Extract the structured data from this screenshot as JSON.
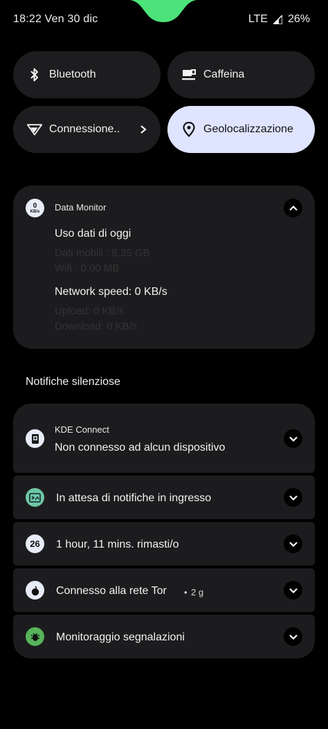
{
  "status_bar": {
    "time_date": "18:22 Ven 30 dic",
    "network": "LTE",
    "battery": "26%"
  },
  "quick_settings": [
    {
      "label": "Bluetooth",
      "icon": "bluetooth-icon",
      "active": false
    },
    {
      "label": "Caffeina",
      "icon": "coffee-cup-icon",
      "active": false
    },
    {
      "label": "Connessione..",
      "icon": "wifi-signal-icon",
      "active": false
    },
    {
      "label": "Geolocalizzazione",
      "icon": "location-pin-icon",
      "active": true
    }
  ],
  "data_monitor": {
    "badge_value": "0",
    "badge_unit": "KB/s",
    "app_name": "Data Monitor",
    "usage_title": "Uso dati di oggi",
    "mobile_data": "Dati mobili : 8,35 GB",
    "wifi": "Wifi : 0,00 MB",
    "speed_title": "Network speed: 0 KB/s",
    "upload": "Upload: 0 KB/s",
    "download": "Download: 0 KB/s"
  },
  "silent_section_title": "Notifiche silenziose",
  "notifications": {
    "kde": {
      "app_name": "KDE Connect",
      "text": "Non connesso ad alcun dispositivo"
    },
    "incoming": {
      "text": "In attesa di notifiche in ingresso"
    },
    "battery": {
      "badge": "26",
      "text": "1 hour, 11 mins. rimasti/o"
    },
    "tor": {
      "text": "Connesso alla rete Tor",
      "age": "2 g"
    },
    "reports": {
      "text": "Monitoraggio segnalazioni"
    }
  },
  "colors": {
    "accent_green": "#4be37a",
    "active_tile": "#dfe4ff",
    "card_bg": "#1c1c1e"
  }
}
